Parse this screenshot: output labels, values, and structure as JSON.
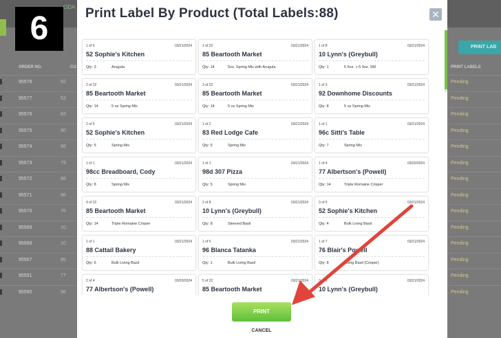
{
  "step": {
    "number": "6"
  },
  "background": {
    "app_subtitle": "ODA",
    "print_labels_button": "PRINT LAB",
    "columns": {
      "order_no": "ORDER NO.",
      "customer": "CU",
      "print_labels": "PRINT LABELS"
    },
    "rows": [
      {
        "order": "95578",
        "cu": "92",
        "status": "Pending"
      },
      {
        "order": "95577",
        "cu": "53",
        "status": "Pending"
      },
      {
        "order": "95576",
        "cu": "83",
        "status": "Pending"
      },
      {
        "order": "95575",
        "cu": "90",
        "status": "Pending"
      },
      {
        "order": "95574",
        "cu": "68",
        "status": "Pending"
      },
      {
        "order": "95573",
        "cu": "79",
        "status": "Pending"
      },
      {
        "order": "95572",
        "cu": "88",
        "status": "Pending"
      },
      {
        "order": "95571",
        "cu": "96",
        "status": "Pending"
      },
      {
        "order": "95570",
        "cu": "76",
        "status": "Pending"
      },
      {
        "order": "95569",
        "cu": "10",
        "status": "Pending"
      },
      {
        "order": "95568",
        "cu": "10",
        "status": "Pending"
      },
      {
        "order": "95567",
        "cu": "85",
        "status": "Pending"
      },
      {
        "order": "95591",
        "cu": "77",
        "status": "Pending"
      },
      {
        "order": "95590",
        "cu": "96",
        "status": "Pending"
      }
    ]
  },
  "modal": {
    "title": "Print Label By Product (Total Labels:88)",
    "close_symbol": "✕",
    "print_button": "PRINT",
    "cancel_button": "CANCEL",
    "cards": [
      {
        "count": "1 of 5",
        "date": "03/21/2024",
        "customer": "52 Sophie's Kitchen",
        "qty": "Qty: 3",
        "product": "Arugula"
      },
      {
        "count": "1 of 22",
        "date": "03/21/2024",
        "customer": "85 Beartooth Market",
        "qty": "Qty: 14",
        "product": "5oz. Spring Mix with Arugula"
      },
      {
        "count": "1 of 8",
        "date": "03/21/2024",
        "customer": "10 Lynn's (Greybull)",
        "qty": "Qty: 1",
        "product": "6 5oz. + 6 9oz. SM"
      },
      {
        "count": "2 of 22",
        "date": "03/21/2024",
        "customer": "85 Beartooth Market",
        "qty": "Qty: 14",
        "product": "5 oz Spring Mix"
      },
      {
        "count": "3 of 22",
        "date": "03/21/2024",
        "customer": "85 Beartooth Market",
        "qty": "Qty: 14",
        "product": "5 oz Spring Mix"
      },
      {
        "count": "1 of 3",
        "date": "03/21/2024",
        "customer": "92 Downhome Discounts",
        "qty": "Qty: 8",
        "product": "5 oz Spring Mix"
      },
      {
        "count": "2 of 5",
        "date": "03/21/2024",
        "customer": "52 Sophie's Kitchen",
        "qty": "Qty: 5",
        "product": "Spring Mix"
      },
      {
        "count": "1 of 2",
        "date": "03/21/2024",
        "customer": "83 Red Lodge Cafe",
        "qty": "Qty: 5",
        "product": "Spring Mix"
      },
      {
        "count": "1 of 1",
        "date": "03/21/2024",
        "customer": "96c Sitti's Table",
        "qty": "Qty: 7",
        "product": "Spring Mix"
      },
      {
        "count": "1 of 1",
        "date": "03/21/2024",
        "customer": "98cc Breadboard, Cody",
        "qty": "Qty: 8",
        "product": "Spring Mix"
      },
      {
        "count": "1 of 1",
        "date": "03/21/2024",
        "customer": "98d 307 Pizza",
        "qty": "Qty: 5",
        "product": "Spring Mix"
      },
      {
        "count": "1 of 4",
        "date": "03/20/2024",
        "customer": "77 Albertson's (Powell)",
        "qty": "Qty: 14",
        "product": "Triple Romaine Crisper"
      },
      {
        "count": "4 of 22",
        "date": "03/21/2024",
        "customer": "85 Beartooth Market",
        "qty": "Qty: 14",
        "product": "Triple Romaine Crisper"
      },
      {
        "count": "2 of 8",
        "date": "03/21/2024",
        "customer": "10 Lynn's (Greybull)",
        "qty": "Qty: 8",
        "product": "Sleeved Basil"
      },
      {
        "count": "3 of 5",
        "date": "03/21/2024",
        "customer": "52 Sophie's Kitchen",
        "qty": "Qty: 4",
        "product": "Bulk Living Basil"
      },
      {
        "count": "1 of 1",
        "date": "03/21/2024",
        "customer": "88 Cattail Bakery",
        "qty": "Qty: 6",
        "product": "Bulk Living Basil"
      },
      {
        "count": "1 of 5",
        "date": "03/21/2024",
        "customer": "96 Blanca Tatanka",
        "qty": "Qty: 1",
        "product": "Bulk Living Basil"
      },
      {
        "count": "1 of 7",
        "date": "03/21/2024",
        "customer": "76 Blair's Powell",
        "qty": "Qty: 8",
        "product": "Living Basil (Crisper)"
      },
      {
        "count": "2 of 4",
        "date": "03/20/2024",
        "customer": "77 Albertson's (Powell)",
        "qty": "",
        "product": ""
      },
      {
        "count": "5 of 22",
        "date": "03/21/2024",
        "customer": "85 Beartooth Market",
        "qty": "",
        "product": ""
      },
      {
        "count": "3 of 8",
        "date": "03/21/2024",
        "customer": "10 Lynn's (Greybull)",
        "qty": "",
        "product": ""
      }
    ]
  },
  "colors": {
    "accent_green": "#5fbf3a",
    "arrow_red": "#e0443a",
    "teal": "#3aa6a8",
    "pending": "#d9c68a"
  }
}
